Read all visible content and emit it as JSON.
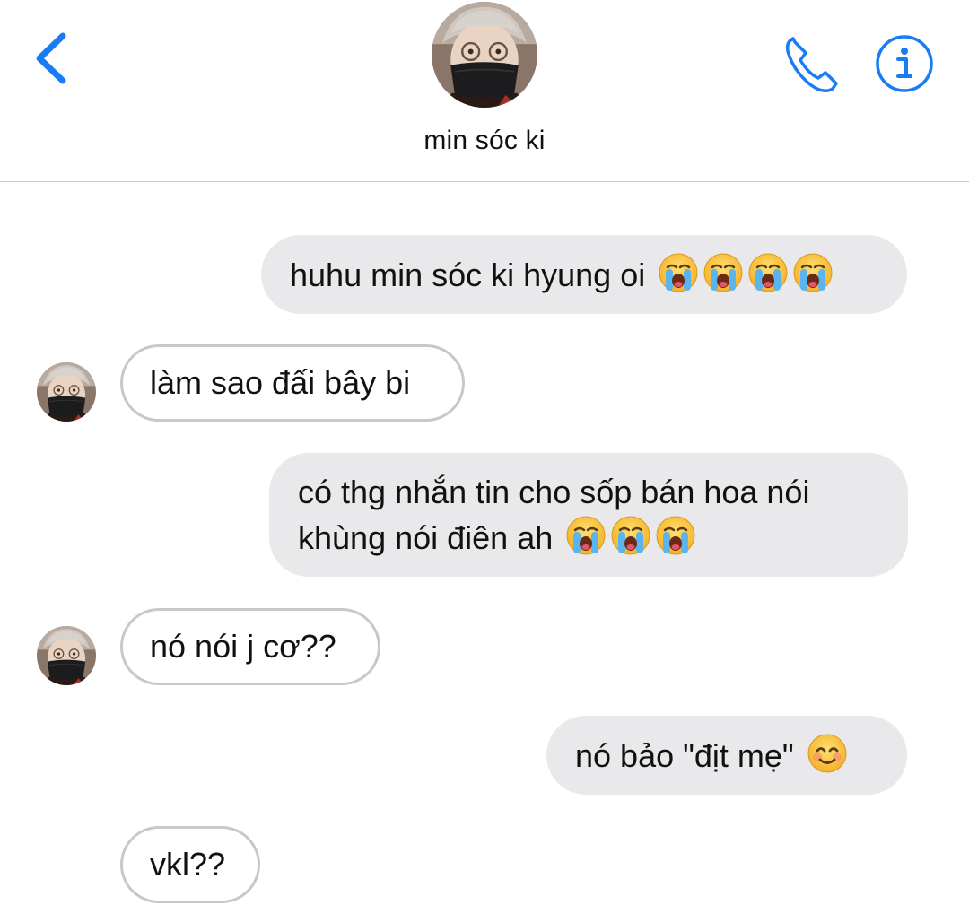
{
  "header": {
    "contact_name": "min sóc ki",
    "accent_color": "#1a7cf5",
    "back_icon": "chevron-left-icon",
    "call_icon": "phone-icon",
    "info_icon": "info-icon"
  },
  "messages": [
    {
      "direction": "outgoing",
      "text": "huhu min sóc ki hyung oi",
      "emoji": [
        "loudly-crying-face",
        "loudly-crying-face",
        "loudly-crying-face",
        "loudly-crying-face"
      ]
    },
    {
      "direction": "incoming",
      "text": "làm sao đấi bây bi"
    },
    {
      "direction": "outgoing",
      "lines": [
        "có thg nhắn tin cho sốp bán hoa nói",
        "khùng nói điên ah"
      ],
      "emoji": [
        "loudly-crying-face",
        "loudly-crying-face",
        "loudly-crying-face"
      ]
    },
    {
      "direction": "incoming",
      "text": "nó nói j cơ??"
    },
    {
      "direction": "outgoing",
      "text": "nó bảo \"địt mẹ\"",
      "emoji": [
        "smiling-face-with-smiling-eyes"
      ]
    },
    {
      "direction": "incoming",
      "text": "vkl??"
    }
  ],
  "colors": {
    "outgoing_bubble": "#e9e9eb",
    "incoming_border": "#c7c7cc"
  }
}
